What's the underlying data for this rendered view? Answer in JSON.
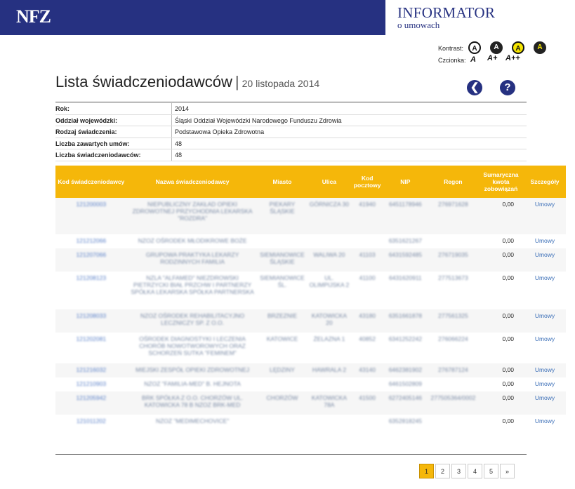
{
  "header": {
    "logo": "NFZ",
    "informator_title": "INFORMATOR",
    "informator_subtitle": "o umowach"
  },
  "accessibility": {
    "contrast_label": "Kontrast:",
    "font_label": "Czcionka:",
    "contrast_options": [
      "A",
      "A",
      "A",
      "A"
    ],
    "font_sizes": [
      "A",
      "A+",
      "A++"
    ]
  },
  "page": {
    "title": "Lista świadczeniodawców",
    "separator": "|",
    "date": "20 listopada 2014",
    "back_icon": "arrow-left-icon",
    "help_icon": "question-icon"
  },
  "meta": [
    {
      "key": "Rok:",
      "value": "2014"
    },
    {
      "key": "Oddział wojewódzki:",
      "value": "Śląski Oddział Wojewódzki Narodowego Funduszu Zdrowia"
    },
    {
      "key": "Rodzaj świadczenia:",
      "value": "Podstawowa Opieka Zdrowotna"
    },
    {
      "key": "Liczba zawartych umów:",
      "value": "48"
    },
    {
      "key": "Liczba świadczeniodawców:",
      "value": "48"
    }
  ],
  "table": {
    "headers": [
      "Kod świadczeniodawcy",
      "Nazwa świadczeniodawcy",
      "Miasto",
      "Ulica",
      "Kod pocztowy",
      "NIP",
      "Regon",
      "Sumaryczna kwota zobowiązań",
      "Szczegóły"
    ],
    "rows": [
      {
        "kod": "121200003",
        "nazwa": "NIEPUBLICZNY ZAKŁAD OPIEKI ZDROWOTNEJ PRZYCHODNIA LEKARSKA \"ROZDRA\"",
        "miasto": "PIEKARY ŚLĄSKIE",
        "ulica": "GÓRNICZA 30",
        "kod_pocztowy": "41940",
        "nip": "6451178946",
        "regon": "276971628",
        "kwota": "0,00",
        "szczegoly": "Umowy"
      },
      {
        "kod": "121212066",
        "nazwa": "NZOZ OŚRODEK MŁODIKROWE BOŻE",
        "miasto": "",
        "ulica": "",
        "kod_pocztowy": "",
        "nip": "6351621267",
        "regon": "",
        "kwota": "0,00",
        "szczegoly": "Umowy"
      },
      {
        "kod": "121207066",
        "nazwa": "GRUPOWA PRAKTYKA LEKARZY RODZINNYCH FAMILIA",
        "miasto": "SIEMIANOWICE ŚLĄSKIE",
        "ulica": "WALIWA 20",
        "kod_pocztowy": "41103",
        "nip": "6431592485",
        "regon": "276719035",
        "kwota": "0,00",
        "szczegoly": "Umowy"
      },
      {
        "kod": "121208123",
        "nazwa": "NZLA \"ALFAMED\" NIEZDROWSKI PIETRZYCKI BIAŁ PRZCHW I PARTNERZY SPÓŁKA LEKARSKA SPÓŁKA PARTNERSKA",
        "miasto": "SIEMIANOWICE ŚL.",
        "ulica": "UL. OLIMPIJSKA 2",
        "kod_pocztowy": "41100",
        "nip": "6431620911",
        "regon": "277513673",
        "kwota": "0,00",
        "szczegoly": "Umowy"
      },
      {
        "kod": "121208033",
        "nazwa": "NZOZ OŚRODEK REHABILITACYJNO LECZNICZY SP. Z O.O.",
        "miasto": "BRZEZNIE",
        "ulica": "KATOWICKA 20",
        "kod_pocztowy": "43180",
        "nip": "6351661878",
        "regon": "277561325",
        "kwota": "0,00",
        "szczegoly": "Umowy"
      },
      {
        "kod": "121202081",
        "nazwa": "OŚRODEK DIAGNOSTYKI I LECZENIA CHORÓB NOWOTWOROWYCH ORAZ SCHORZEŃ SUTKA \"FEMINEM\"",
        "miasto": "KATOWICE",
        "ulica": "ŻELAZNA 1",
        "kod_pocztowy": "40852",
        "nip": "6341252242",
        "regon": "276066224",
        "kwota": "0,00",
        "szczegoly": "Umowy"
      },
      {
        "kod": "121216032",
        "nazwa": "MIEJSKI ZESPÓŁ OPIEKI ZDROWOTNEJ",
        "miasto": "LĘDZINY",
        "ulica": "HAWRALA 2",
        "kod_pocztowy": "43140",
        "nip": "6462381902",
        "regon": "276787124",
        "kwota": "0,00",
        "szczegoly": "Umowy"
      },
      {
        "kod": "121210903",
        "nazwa": "NZOZ \"FAMILIA-MED\" B. HEJNOTA",
        "miasto": "",
        "ulica": "",
        "kod_pocztowy": "",
        "nip": "6461502809",
        "regon": "",
        "kwota": "0,00",
        "szczegoly": "Umowy"
      },
      {
        "kod": "121205942",
        "nazwa": "BRK SPÓŁKA Z O.O. CHORZÓW UL. KATOWICKA 78 B NZOZ BRK-MED",
        "miasto": "CHORZÓW",
        "ulica": "KATOWICKA 78A",
        "kod_pocztowy": "41500",
        "nip": "6272405146",
        "regon": "277505364/0002",
        "kwota": "0,00",
        "szczegoly": "Umowy"
      },
      {
        "kod": "121011202",
        "nazwa": "NZOZ \"MEDIMECHOVICE\"",
        "miasto": "",
        "ulica": "",
        "kod_pocztowy": "",
        "nip": "6352818245",
        "regon": "",
        "kwota": "0,00",
        "szczegoly": "Umowy"
      }
    ]
  },
  "pagination": {
    "pages": [
      "1",
      "2",
      "3",
      "4",
      "5",
      "»"
    ],
    "current": "1"
  },
  "colors": {
    "brand_navy": "#263181",
    "table_header": "#f5b70a",
    "link": "#3d70b8"
  }
}
